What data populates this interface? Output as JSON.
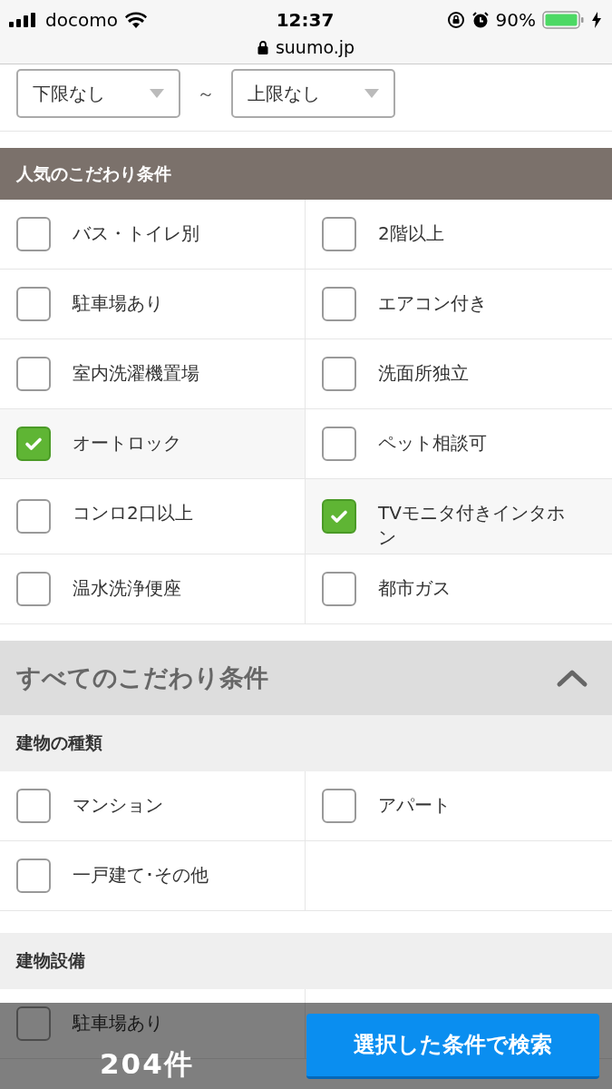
{
  "status_bar": {
    "carrier": "docomo",
    "time": "12:37",
    "battery": "90%",
    "url": "suumo.jp"
  },
  "price_range": {
    "min": "下限なし",
    "separator": "～",
    "max": "上限なし"
  },
  "popular": {
    "title": "人気のこだわり条件",
    "items": [
      {
        "label": "バス・トイレ別",
        "checked": false
      },
      {
        "label": "2階以上",
        "checked": false
      },
      {
        "label": "駐車場あり",
        "checked": false
      },
      {
        "label": "エアコン付き",
        "checked": false
      },
      {
        "label": "室内洗濯機置場",
        "checked": false
      },
      {
        "label": "洗面所独立",
        "checked": false
      },
      {
        "label": "オートロック",
        "checked": true
      },
      {
        "label": "ペット相談可",
        "checked": false
      },
      {
        "label": "コンロ2口以上",
        "checked": false
      },
      {
        "label": "TVモニタ付きインタホン",
        "checked": true
      },
      {
        "label": "温水洗浄便座",
        "checked": false
      },
      {
        "label": "都市ガス",
        "checked": false
      }
    ]
  },
  "all_conditions": {
    "title": "すべてのこだわり条件",
    "expanded": true,
    "groups": [
      {
        "title": "建物の種類",
        "items": [
          {
            "label": "マンション",
            "checked": false
          },
          {
            "label": "アパート",
            "checked": false
          },
          {
            "label": "一戸建て･その他",
            "checked": false
          }
        ]
      },
      {
        "title": "建物設備",
        "items": [
          {
            "label": "駐車場あり",
            "checked": false
          }
        ]
      }
    ]
  },
  "bottom_bar": {
    "count": "204件",
    "search_button": "選択した条件で検索"
  }
}
